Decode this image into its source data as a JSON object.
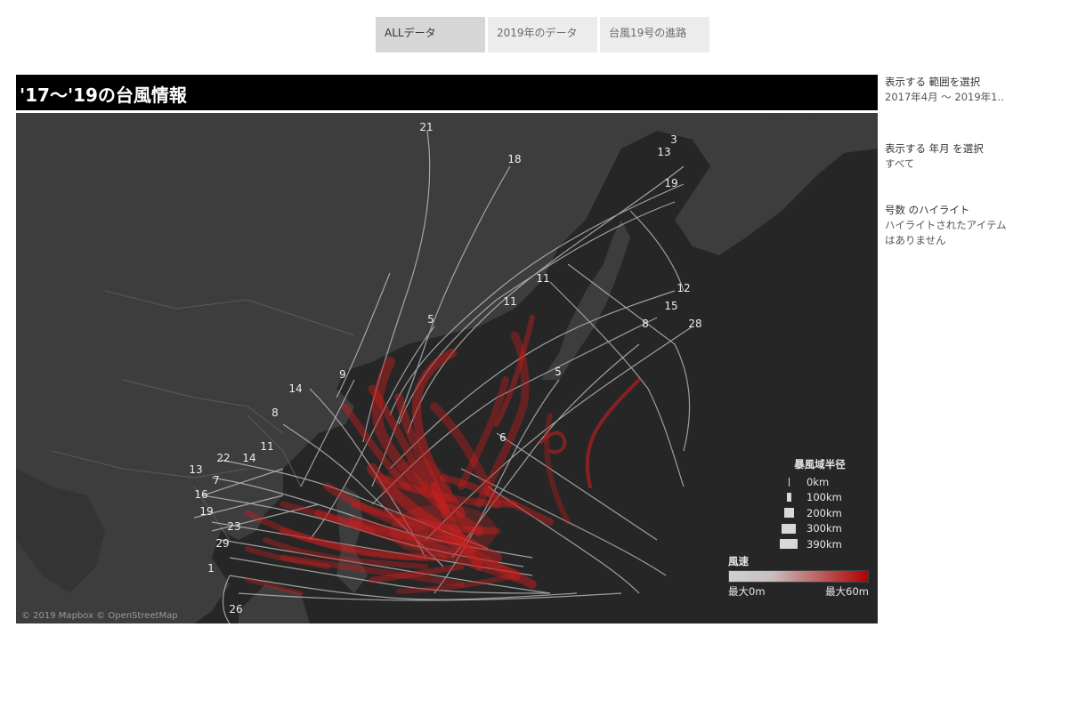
{
  "tabs": [
    "ALLデータ",
    "2019年のデータ",
    "台風19号の進路"
  ],
  "title": "'17～'19の台風情報",
  "map": {
    "credit": "© 2019 Mapbox © OpenStreetMap",
    "storm_labels": [
      "21",
      "18",
      "3",
      "13",
      "19",
      "11",
      "11",
      "12",
      "15",
      "28",
      "8",
      "5",
      "5",
      "9",
      "14",
      "8",
      "6",
      "11",
      "22",
      "14",
      "13",
      "7",
      "16",
      "19",
      "23",
      "29",
      "1",
      "26"
    ]
  },
  "legend_size": {
    "title": "暴風域半径",
    "items": [
      "0km",
      "100km",
      "200km",
      "300km",
      "390km"
    ]
  },
  "legend_color": {
    "title": "風速",
    "min": "最大0m",
    "max": "最大60m",
    "low_color": "#d0d0d0",
    "high_color": "#b00000"
  },
  "filters": {
    "range_label": "表示する 範囲を選択",
    "range_value": "2017年4月 ～ 2019年1..",
    "month_label": "表示する 年月 を選択",
    "month_value": "すべて",
    "highlight_label": "号数 のハイライト",
    "highlight_value": "ハイライトされたアイテムはありません"
  },
  "colors": {
    "map_bg": "#262626",
    "land": "#3d3d3d",
    "track": "#c8c8c8",
    "accent_red": "#c81e1e"
  }
}
